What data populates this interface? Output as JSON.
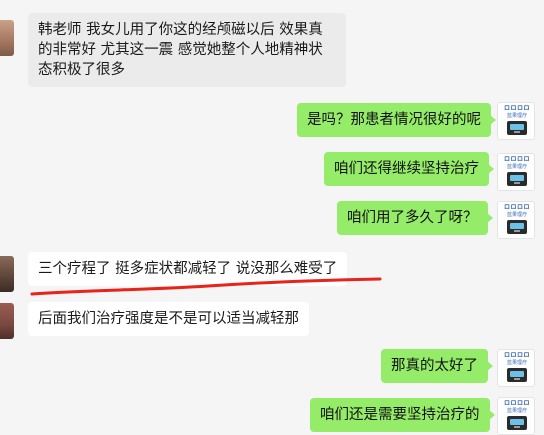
{
  "messages": [
    {
      "side": "left",
      "text": "韩老师 我女儿用了你这的经颅磁以后 效果真的非常好  尤其这一震 感觉她整个人地精神状态积极了很多"
    },
    {
      "side": "right",
      "text": "是吗？那患者情况很好的呢"
    },
    {
      "side": "right",
      "text": "咱们还得继续坚持治疗"
    },
    {
      "side": "right",
      "text": "咱们用了多久了呀？"
    },
    {
      "side": "left",
      "text": "三个疗程了 挺多症状都减轻了 说没那么难受了"
    },
    {
      "side": "left",
      "text": "后面我们治疗强度是不是可以适当减轻那"
    },
    {
      "side": "right",
      "text": "那真的太好了"
    },
    {
      "side": "right",
      "text": "咱们还是需要坚持治疗的"
    }
  ],
  "avatar": {
    "brand": "ロロロロ",
    "brand2": "蓝果理疗"
  },
  "colors": {
    "sent_bubble": "#95ec69",
    "received_bubble": "#ebebeb",
    "background": "#f5f5f5",
    "annotation_stroke": "#e8231a"
  }
}
